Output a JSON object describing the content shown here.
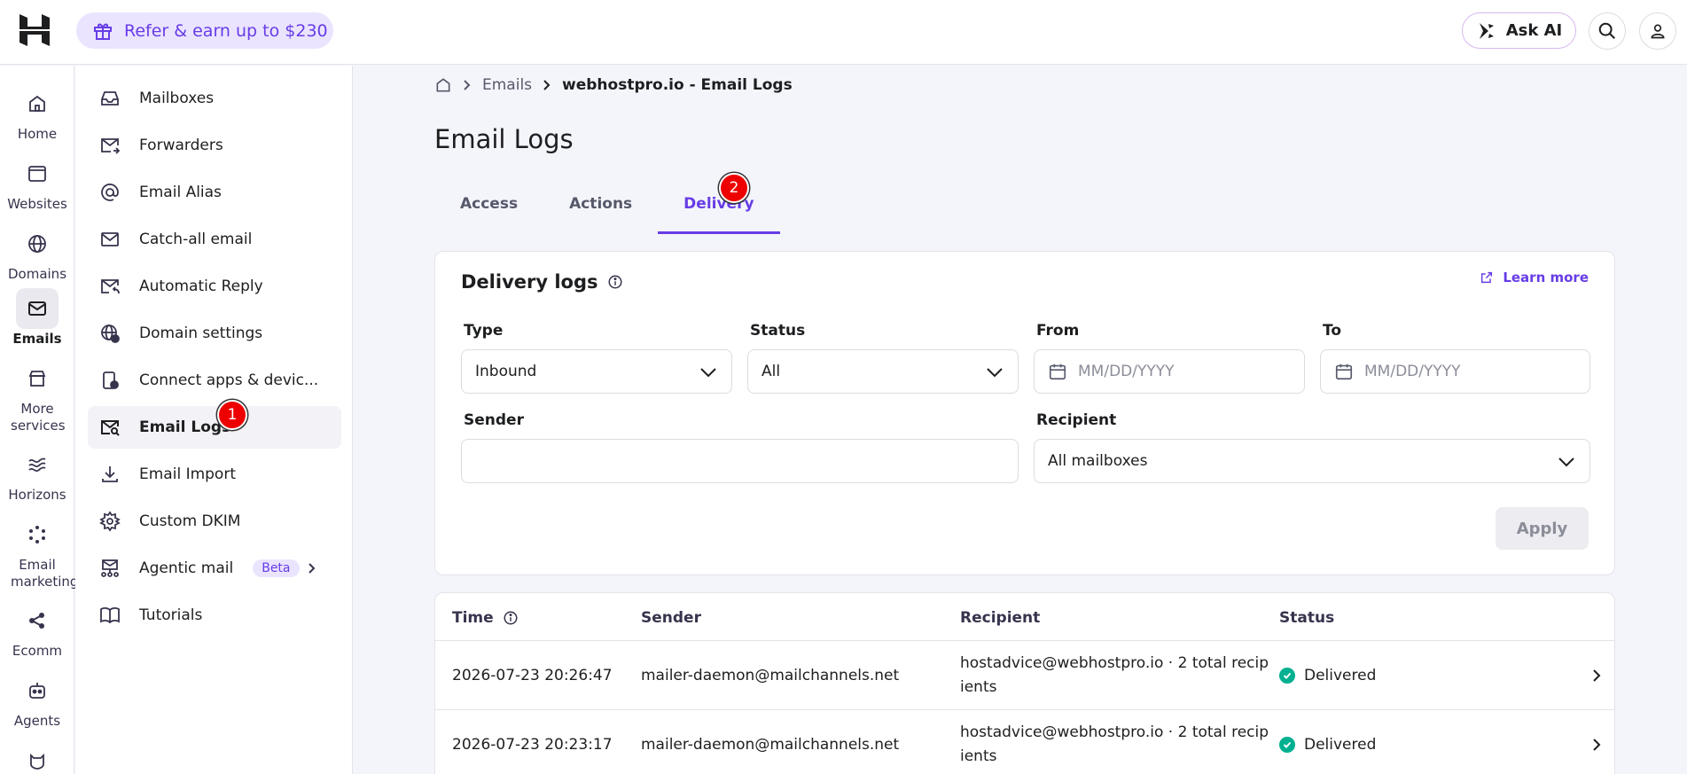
{
  "topbar": {
    "refer_label": "Refer & earn up to $230",
    "ask_ai_label": "Ask AI"
  },
  "rail": [
    {
      "label": "Home",
      "icon": "home-icon"
    },
    {
      "label": "Websites",
      "icon": "websites-icon"
    },
    {
      "label": "Domains",
      "icon": "globe-icon"
    },
    {
      "label": "Emails",
      "icon": "mail-icon",
      "active": true
    },
    {
      "label": "More services",
      "icon": "services-icon"
    },
    {
      "label": "Horizons",
      "icon": "horizons-icon"
    },
    {
      "label": "Email marketing",
      "icon": "marketing-icon"
    },
    {
      "label": "Ecomm",
      "icon": "ecomm-icon"
    },
    {
      "label": "Agents",
      "icon": "agents-icon"
    }
  ],
  "menu": [
    {
      "label": "Mailboxes",
      "icon": "inbox-icon"
    },
    {
      "label": "Forwarders",
      "icon": "forward-mail-icon"
    },
    {
      "label": "Email Alias",
      "icon": "at-icon"
    },
    {
      "label": "Catch-all email",
      "icon": "envelope-icon"
    },
    {
      "label": "Automatic Reply",
      "icon": "auto-reply-icon"
    },
    {
      "label": "Domain settings",
      "icon": "globe-settings-icon"
    },
    {
      "label": "Connect apps & devic...",
      "icon": "device-plus-icon"
    },
    {
      "label": "Email Logs",
      "icon": "mail-search-icon",
      "active": true
    },
    {
      "label": "Email Import",
      "icon": "download-icon"
    },
    {
      "label": "Custom DKIM",
      "icon": "gear-icon"
    },
    {
      "label": "Agentic mail",
      "icon": "agent-mail-icon",
      "beta": "Beta"
    },
    {
      "label": "Tutorials",
      "icon": "book-icon"
    }
  ],
  "badges": {
    "one": "1",
    "two": "2"
  },
  "breadcrumb": {
    "parent": "Emails",
    "current": "webhostpro.io - Email Logs"
  },
  "page_title": "Email Logs",
  "tabs": [
    "Access",
    "Actions",
    "Delivery"
  ],
  "card": {
    "title": "Delivery logs",
    "learn_more": "Learn more",
    "type_label": "Type",
    "type_value": "Inbound",
    "status_label": "Status",
    "status_value": "All",
    "from_label": "From",
    "from_placeholder": "MM/DD/YYYY",
    "to_label": "To",
    "to_placeholder": "MM/DD/YYYY",
    "sender_label": "Sender",
    "sender_value": "",
    "recipient_label": "Recipient",
    "recipient_value": "All mailboxes",
    "apply_label": "Apply"
  },
  "table": {
    "headers": {
      "time": "Time",
      "sender": "Sender",
      "recipient": "Recipient",
      "status": "Status"
    },
    "rows": [
      {
        "time": "2026-07-23 20:26:47",
        "sender": "mailer-daemon@mailchannels.net",
        "recipient": "hostadvice@webhostpro.io · 2 total recip ients",
        "status": "Delivered"
      },
      {
        "time": "2026-07-23 20:23:17",
        "sender": "mailer-daemon@mailchannels.net",
        "recipient": "hostadvice@webhostpro.io · 2 total recip ients",
        "status": "Delivered"
      }
    ]
  },
  "colors": {
    "accent": "#673de6",
    "delivered": "#00b090",
    "badge": "#e00000"
  }
}
